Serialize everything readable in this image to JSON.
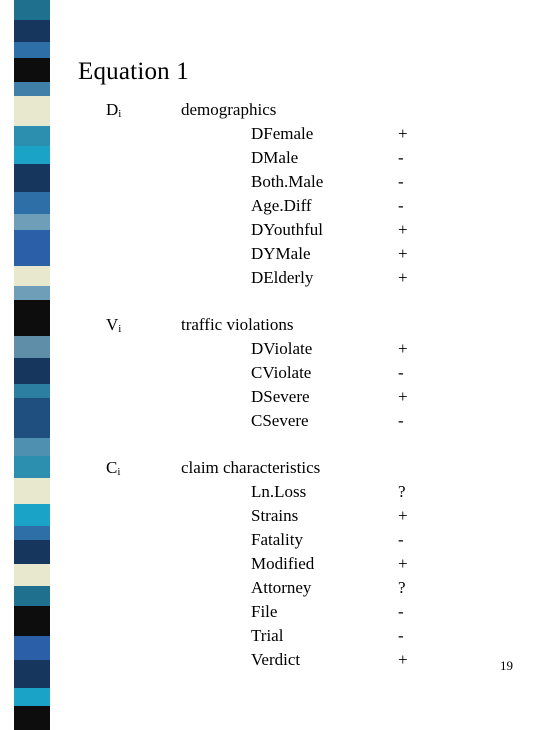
{
  "slide": {
    "title": "Equation 1",
    "page_number": "19"
  },
  "groups": [
    {
      "symbol": "D",
      "subscript": "i",
      "label": "demographics",
      "rows": [
        {
          "name": "DFemale",
          "sign": "+"
        },
        {
          "name": "DMale",
          "sign": "-"
        },
        {
          "name": "Both.Male",
          "sign": "-"
        },
        {
          "name": "Age.Diff",
          "sign": "-"
        },
        {
          "name": "DYouthful",
          "sign": "+"
        },
        {
          "name": "DYMale",
          "sign": "+"
        },
        {
          "name": "DElderly",
          "sign": "+"
        }
      ]
    },
    {
      "symbol": "V",
      "subscript": "i",
      "label": "traffic violations",
      "rows": [
        {
          "name": "DViolate",
          "sign": "+"
        },
        {
          "name": "CViolate",
          "sign": "-"
        },
        {
          "name": "DSevere",
          "sign": "+"
        },
        {
          "name": "CSevere",
          "sign": "-"
        }
      ]
    },
    {
      "symbol": "C",
      "subscript": "i",
      "label": "claim characteristics",
      "rows": [
        {
          "name": "Ln.Loss",
          "sign": "?"
        },
        {
          "name": "Strains",
          "sign": "+"
        },
        {
          "name": "Fatality",
          "sign": "-"
        },
        {
          "name": "Modified",
          "sign": "+"
        },
        {
          "name": "Attorney",
          "sign": "?"
        },
        {
          "name": "File",
          "sign": "-"
        },
        {
          "name": "Trial",
          "sign": "-"
        },
        {
          "name": "Verdict",
          "sign": "+"
        }
      ]
    }
  ],
  "decor": {
    "strip_colors": [
      {
        "color": "#1f6f8f",
        "height": 20
      },
      {
        "color": "#17365d",
        "height": 22
      },
      {
        "color": "#2f6fa8",
        "height": 16
      },
      {
        "color": "#0d0d0d",
        "height": 24
      },
      {
        "color": "#3f7fa8",
        "height": 14
      },
      {
        "color": "#e8e8cf",
        "height": 30
      },
      {
        "color": "#2c8fb0",
        "height": 20
      },
      {
        "color": "#1aa3c7",
        "height": 18
      },
      {
        "color": "#17365d",
        "height": 28
      },
      {
        "color": "#2f6fa8",
        "height": 22
      },
      {
        "color": "#6f9fb8",
        "height": 16
      },
      {
        "color": "#2b5fa8",
        "height": 36
      },
      {
        "color": "#e8e8cf",
        "height": 20
      },
      {
        "color": "#6f9fb8",
        "height": 14
      },
      {
        "color": "#0d0d0d",
        "height": 36
      },
      {
        "color": "#5f8fa8",
        "height": 22
      },
      {
        "color": "#17365d",
        "height": 26
      },
      {
        "color": "#2c7fa0",
        "height": 14
      },
      {
        "color": "#1f4f7f",
        "height": 40
      },
      {
        "color": "#4f8fb0",
        "height": 18
      },
      {
        "color": "#2c8fb0",
        "height": 22
      },
      {
        "color": "#e8e8cf",
        "height": 26
      },
      {
        "color": "#1aa3c7",
        "height": 22
      },
      {
        "color": "#2f6fa8",
        "height": 14
      },
      {
        "color": "#17365d",
        "height": 24
      },
      {
        "color": "#e8e8cf",
        "height": 22
      },
      {
        "color": "#1f6f8f",
        "height": 20
      },
      {
        "color": "#0d0d0d",
        "height": 30
      },
      {
        "color": "#2b5fa8",
        "height": 24
      },
      {
        "color": "#17365d",
        "height": 28
      },
      {
        "color": "#1aa3c7",
        "height": 18
      },
      {
        "color": "#0d0d0d",
        "height": 24
      }
    ]
  }
}
